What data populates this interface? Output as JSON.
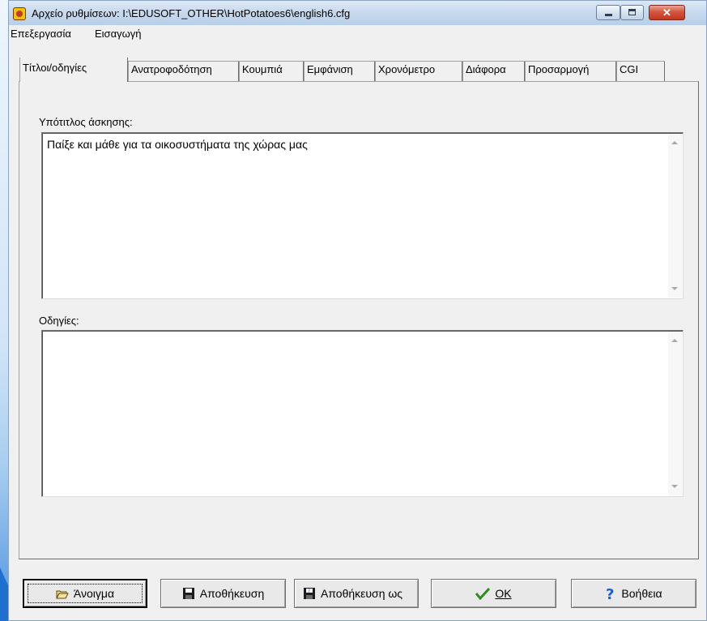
{
  "window": {
    "title": "Αρχείο ρυθμίσεων:  I:\\EDUSOFT_OTHER\\HotPotatoes6\\english6.cfg"
  },
  "menu": [
    "Επεξεργασία",
    "Εισαγωγή"
  ],
  "tabs": [
    {
      "label": "Τίτλοι/οδηγίες",
      "active": true
    },
    {
      "label": "Ανατροφοδότηση",
      "active": false
    },
    {
      "label": "Κουμπιά",
      "active": false
    },
    {
      "label": "Εμφάνιση",
      "active": false
    },
    {
      "label": "Χρονόμετρο",
      "active": false
    },
    {
      "label": "Διάφορα",
      "active": false
    },
    {
      "label": "Προσαρμογή",
      "active": false
    },
    {
      "label": "CGI",
      "active": false
    }
  ],
  "fields": {
    "subtitle_label": "Υπότιτλος άσκησης:",
    "subtitle_value": "Παίξε και μάθε για τα οικοσυστήματα της χώρας μας",
    "instructions_label": "Οδηγίες:",
    "instructions_value": ""
  },
  "buttons": {
    "open": "Άνοιγμα",
    "save": "Αποθήκευση",
    "save_as": "Αποθήκευση ως",
    "ok": "OK",
    "help": "Βοήθεια"
  },
  "colors": {
    "window_bg": "#f0f0f0",
    "close_button": "#c4361e",
    "ok_check": "#2e8b1f",
    "help_icon": "#1a5fd0"
  },
  "icons": [
    "app-hotpotatoes-icon",
    "minimize-icon",
    "maximize-icon",
    "close-icon",
    "folder-open-icon",
    "floppy-disk-icon",
    "save-as-icon",
    "checkmark-icon",
    "help-icon"
  ]
}
